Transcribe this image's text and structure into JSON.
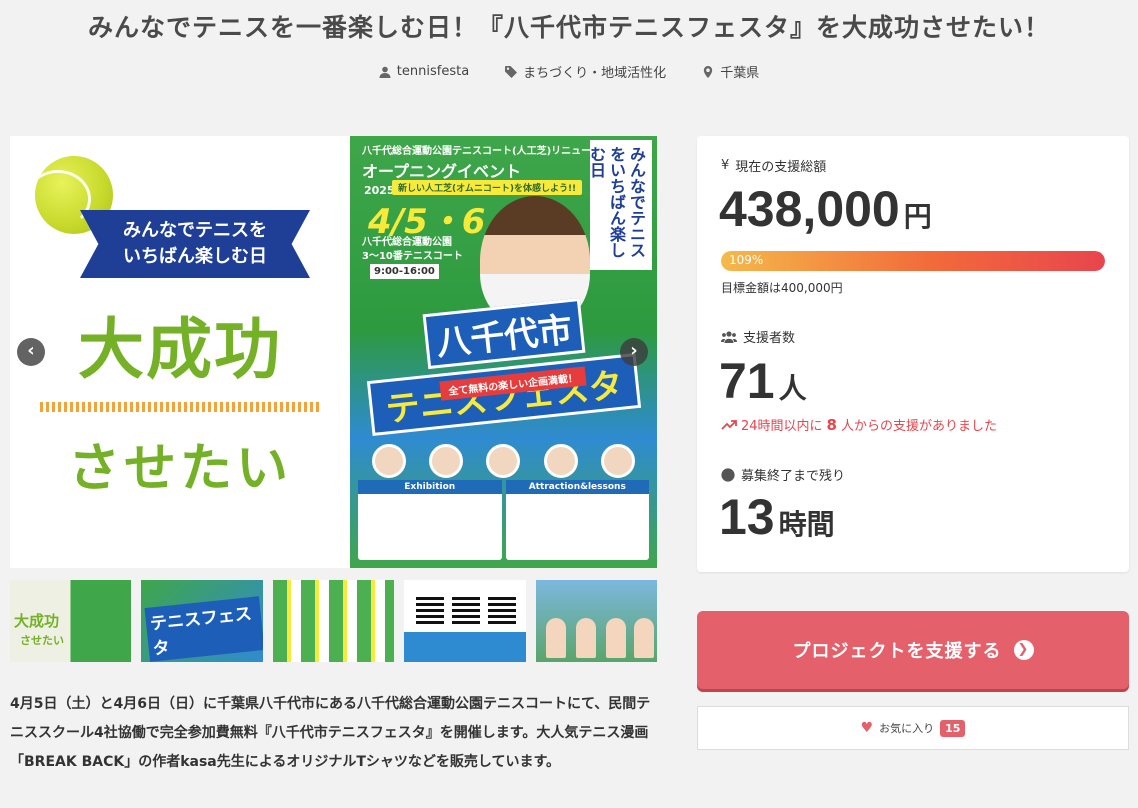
{
  "title": "みんなでテニスを一番楽しむ日！『八千代市テニスフェスタ』を大成功させたい！",
  "meta": {
    "owner": "tennisfesta",
    "category": "まちづくり・地域活性化",
    "location": "千葉県"
  },
  "slides": {
    "slide1": {
      "ribbon_line1": "みんなでテニスを",
      "ribbon_line2": "いちばん楽しむ日",
      "big1": "大成功",
      "big2": "させたい"
    },
    "slide2": {
      "head": "八千代総合運動公園テニスコート(人工芝)リニューアル",
      "opening": "オープニングイベント",
      "sub": "新しい人工芝(オムニコート)を体感しよう!!",
      "year": "2025",
      "date": "4/5・6",
      "venue": "八千代総合運動公園",
      "courts": "3〜10番テニスコート",
      "hours": "9:00-16:00",
      "vertical": "みんなでテニスをいちばん楽しむ日",
      "logo1": "八千代市",
      "logo2": "テニスフェスタ",
      "tag": "全て無料の楽しい企画満載！",
      "exhibition": "Exhibition",
      "attraction": "Attraction&lessons"
    }
  },
  "thumbs": {
    "t1_text": "大成功",
    "t1_text2": "させたい",
    "t2_text": "テニスフェスタ"
  },
  "description": "4月5日（土）と4月6日（日）に千葉県八千代市にある八千代総合運動公園テニスコートにて、民間テニススクール4社協働で完全参加費無料『八千代市テニスフェスタ』を開催します。大人気テニス漫画「BREAK BACK」の作者kasa先生によるオリジナルTシャツなどを販売しています。",
  "stats": {
    "total_label": "現在の支援総額",
    "total_value": "438,000",
    "total_unit": "円",
    "progress_percent": 109,
    "progress_label": "109%",
    "goal_text": "目標金額は400,000円",
    "supporters_label": "支援者数",
    "supporters_value": "71",
    "supporters_unit": "人",
    "trend_prefix": "24時間以内に",
    "trend_count": "8",
    "trend_suffix": "人からの支援がありました",
    "remaining_label": "募集終了まで残り",
    "remaining_value": "13",
    "remaining_unit": "時間"
  },
  "support_button": "プロジェクトを支援する",
  "favorite": {
    "label": "お気に入り",
    "count": "15"
  },
  "colors": {
    "accent": "#e4606a",
    "trend": "#e8454d"
  }
}
